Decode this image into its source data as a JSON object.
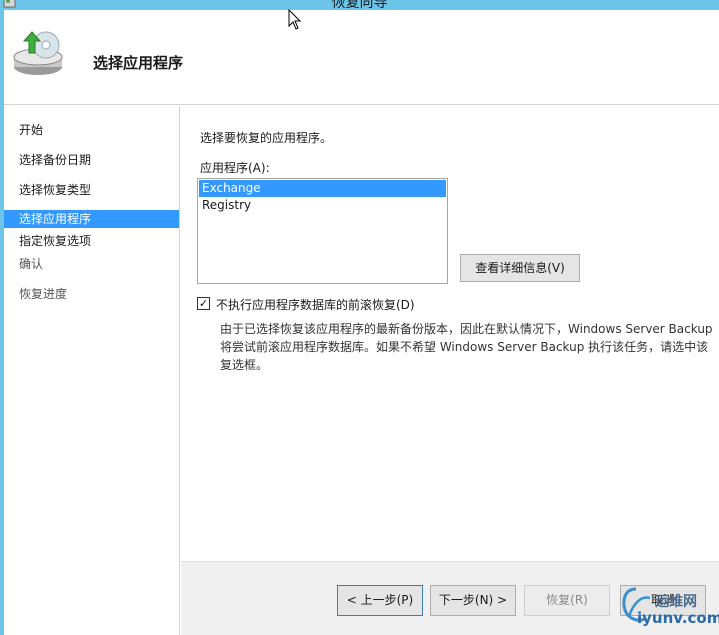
{
  "window": {
    "title": "恢复向导"
  },
  "header": {
    "title": "选择应用程序"
  },
  "nav": {
    "items": [
      {
        "label": "开始"
      },
      {
        "label": "选择备份日期"
      },
      {
        "label": "选择恢复类型"
      },
      {
        "label": "选择应用程序"
      },
      {
        "label": "指定恢复选项"
      },
      {
        "label": "确认"
      },
      {
        "label": "恢复进度"
      }
    ],
    "active_index": 3
  },
  "main": {
    "prompt": "选择要恢复的应用程序。",
    "app_label": "应用程序(A):",
    "applications": [
      "Exchange",
      "Registry"
    ],
    "selected_application": "Exchange",
    "details_button": "查看详细信息(V)",
    "checkbox": {
      "label": "不执行应用程序数据库的前滚恢复(D)",
      "checked": true
    },
    "description": "由于已选择恢复该应用程序的最新备份版本，因此在默认情况下，Windows Server Backup 将尝试前滚应用程序数据库。如果不希望 Windows Server Backup 执行该任务，请选中该复选框。"
  },
  "footer": {
    "prev": "< 上一步(P)",
    "next": "下一步(N) >",
    "restore": "恢复(R)",
    "cancel": "取消"
  },
  "watermark": {
    "cn": "运维网",
    "domain": "iyunv.com"
  },
  "colors": {
    "frame": "#6cc4e8",
    "selection": "#3399ff",
    "footer_bg": "#f0f0f0"
  }
}
